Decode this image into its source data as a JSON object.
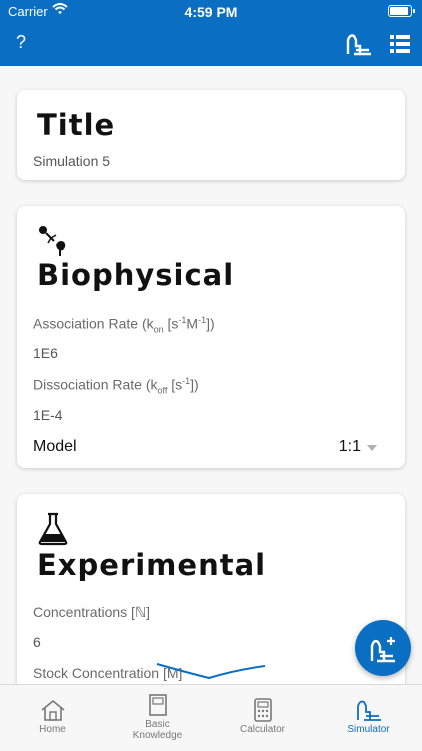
{
  "status_bar": {
    "carrier": "Carrier",
    "time": "4:59 PM"
  },
  "app_bar": {
    "help_label": "?"
  },
  "title_card": {
    "heading": "Title",
    "value": "Simulation 5"
  },
  "biophysical_card": {
    "heading": "Biophysical",
    "assoc_label_prefix": "Association Rate (k",
    "assoc_label_sub": "on",
    "assoc_label_mid1": " [s",
    "assoc_label_sup1": "-1",
    "assoc_label_mid2": "M",
    "assoc_label_sup2": "-1",
    "assoc_label_suffix": "])",
    "assoc_value": "1E6",
    "dissoc_label_prefix": "Dissociation Rate (k",
    "dissoc_label_sub": "off",
    "dissoc_label_mid": " [s",
    "dissoc_label_sup": "-1",
    "dissoc_label_suffix": "])",
    "dissoc_value": "1E-4",
    "model_label": "Model",
    "model_value": "1:1"
  },
  "experimental_card": {
    "heading": "Experimental",
    "conc_label": "Concentrations [ℕ]",
    "conc_value": "6",
    "stock_label": "Stock Concentration [M]"
  },
  "tabs": [
    {
      "label": "Home",
      "icon": "house-icon",
      "active": false
    },
    {
      "label": "Basic Knowledge",
      "icon": "book-icon",
      "active": false
    },
    {
      "label": "Calculator",
      "icon": "calculator-icon",
      "active": false
    },
    {
      "label": "Simulator",
      "icon": "sensorgram-icon",
      "active": true
    }
  ],
  "colors": {
    "primary": "#0a6fc2",
    "inactive_tab": "#777777"
  }
}
